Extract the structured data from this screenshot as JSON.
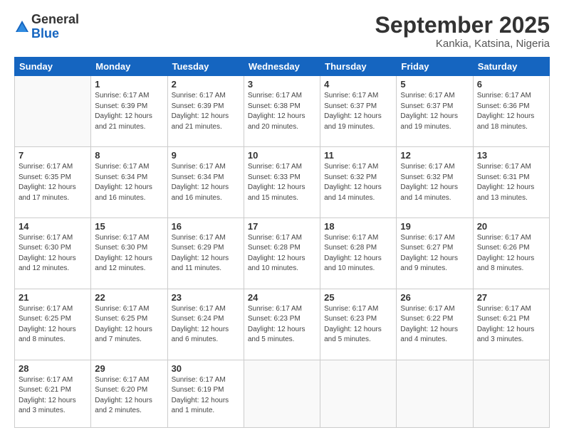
{
  "header": {
    "logo_line1": "General",
    "logo_line2": "Blue",
    "month": "September 2025",
    "location": "Kankia, Katsina, Nigeria"
  },
  "weekdays": [
    "Sunday",
    "Monday",
    "Tuesday",
    "Wednesday",
    "Thursday",
    "Friday",
    "Saturday"
  ],
  "weeks": [
    [
      {
        "day": "",
        "info": ""
      },
      {
        "day": "1",
        "info": "Sunrise: 6:17 AM\nSunset: 6:39 PM\nDaylight: 12 hours\nand 21 minutes."
      },
      {
        "day": "2",
        "info": "Sunrise: 6:17 AM\nSunset: 6:39 PM\nDaylight: 12 hours\nand 21 minutes."
      },
      {
        "day": "3",
        "info": "Sunrise: 6:17 AM\nSunset: 6:38 PM\nDaylight: 12 hours\nand 20 minutes."
      },
      {
        "day": "4",
        "info": "Sunrise: 6:17 AM\nSunset: 6:37 PM\nDaylight: 12 hours\nand 19 minutes."
      },
      {
        "day": "5",
        "info": "Sunrise: 6:17 AM\nSunset: 6:37 PM\nDaylight: 12 hours\nand 19 minutes."
      },
      {
        "day": "6",
        "info": "Sunrise: 6:17 AM\nSunset: 6:36 PM\nDaylight: 12 hours\nand 18 minutes."
      }
    ],
    [
      {
        "day": "7",
        "info": "Sunrise: 6:17 AM\nSunset: 6:35 PM\nDaylight: 12 hours\nand 17 minutes."
      },
      {
        "day": "8",
        "info": "Sunrise: 6:17 AM\nSunset: 6:34 PM\nDaylight: 12 hours\nand 16 minutes."
      },
      {
        "day": "9",
        "info": "Sunrise: 6:17 AM\nSunset: 6:34 PM\nDaylight: 12 hours\nand 16 minutes."
      },
      {
        "day": "10",
        "info": "Sunrise: 6:17 AM\nSunset: 6:33 PM\nDaylight: 12 hours\nand 15 minutes."
      },
      {
        "day": "11",
        "info": "Sunrise: 6:17 AM\nSunset: 6:32 PM\nDaylight: 12 hours\nand 14 minutes."
      },
      {
        "day": "12",
        "info": "Sunrise: 6:17 AM\nSunset: 6:32 PM\nDaylight: 12 hours\nand 14 minutes."
      },
      {
        "day": "13",
        "info": "Sunrise: 6:17 AM\nSunset: 6:31 PM\nDaylight: 12 hours\nand 13 minutes."
      }
    ],
    [
      {
        "day": "14",
        "info": "Sunrise: 6:17 AM\nSunset: 6:30 PM\nDaylight: 12 hours\nand 12 minutes."
      },
      {
        "day": "15",
        "info": "Sunrise: 6:17 AM\nSunset: 6:30 PM\nDaylight: 12 hours\nand 12 minutes."
      },
      {
        "day": "16",
        "info": "Sunrise: 6:17 AM\nSunset: 6:29 PM\nDaylight: 12 hours\nand 11 minutes."
      },
      {
        "day": "17",
        "info": "Sunrise: 6:17 AM\nSunset: 6:28 PM\nDaylight: 12 hours\nand 10 minutes."
      },
      {
        "day": "18",
        "info": "Sunrise: 6:17 AM\nSunset: 6:28 PM\nDaylight: 12 hours\nand 10 minutes."
      },
      {
        "day": "19",
        "info": "Sunrise: 6:17 AM\nSunset: 6:27 PM\nDaylight: 12 hours\nand 9 minutes."
      },
      {
        "day": "20",
        "info": "Sunrise: 6:17 AM\nSunset: 6:26 PM\nDaylight: 12 hours\nand 8 minutes."
      }
    ],
    [
      {
        "day": "21",
        "info": "Sunrise: 6:17 AM\nSunset: 6:25 PM\nDaylight: 12 hours\nand 8 minutes."
      },
      {
        "day": "22",
        "info": "Sunrise: 6:17 AM\nSunset: 6:25 PM\nDaylight: 12 hours\nand 7 minutes."
      },
      {
        "day": "23",
        "info": "Sunrise: 6:17 AM\nSunset: 6:24 PM\nDaylight: 12 hours\nand 6 minutes."
      },
      {
        "day": "24",
        "info": "Sunrise: 6:17 AM\nSunset: 6:23 PM\nDaylight: 12 hours\nand 5 minutes."
      },
      {
        "day": "25",
        "info": "Sunrise: 6:17 AM\nSunset: 6:23 PM\nDaylight: 12 hours\nand 5 minutes."
      },
      {
        "day": "26",
        "info": "Sunrise: 6:17 AM\nSunset: 6:22 PM\nDaylight: 12 hours\nand 4 minutes."
      },
      {
        "day": "27",
        "info": "Sunrise: 6:17 AM\nSunset: 6:21 PM\nDaylight: 12 hours\nand 3 minutes."
      }
    ],
    [
      {
        "day": "28",
        "info": "Sunrise: 6:17 AM\nSunset: 6:21 PM\nDaylight: 12 hours\nand 3 minutes."
      },
      {
        "day": "29",
        "info": "Sunrise: 6:17 AM\nSunset: 6:20 PM\nDaylight: 12 hours\nand 2 minutes."
      },
      {
        "day": "30",
        "info": "Sunrise: 6:17 AM\nSunset: 6:19 PM\nDaylight: 12 hours\nand 1 minute."
      },
      {
        "day": "",
        "info": ""
      },
      {
        "day": "",
        "info": ""
      },
      {
        "day": "",
        "info": ""
      },
      {
        "day": "",
        "info": ""
      }
    ]
  ]
}
